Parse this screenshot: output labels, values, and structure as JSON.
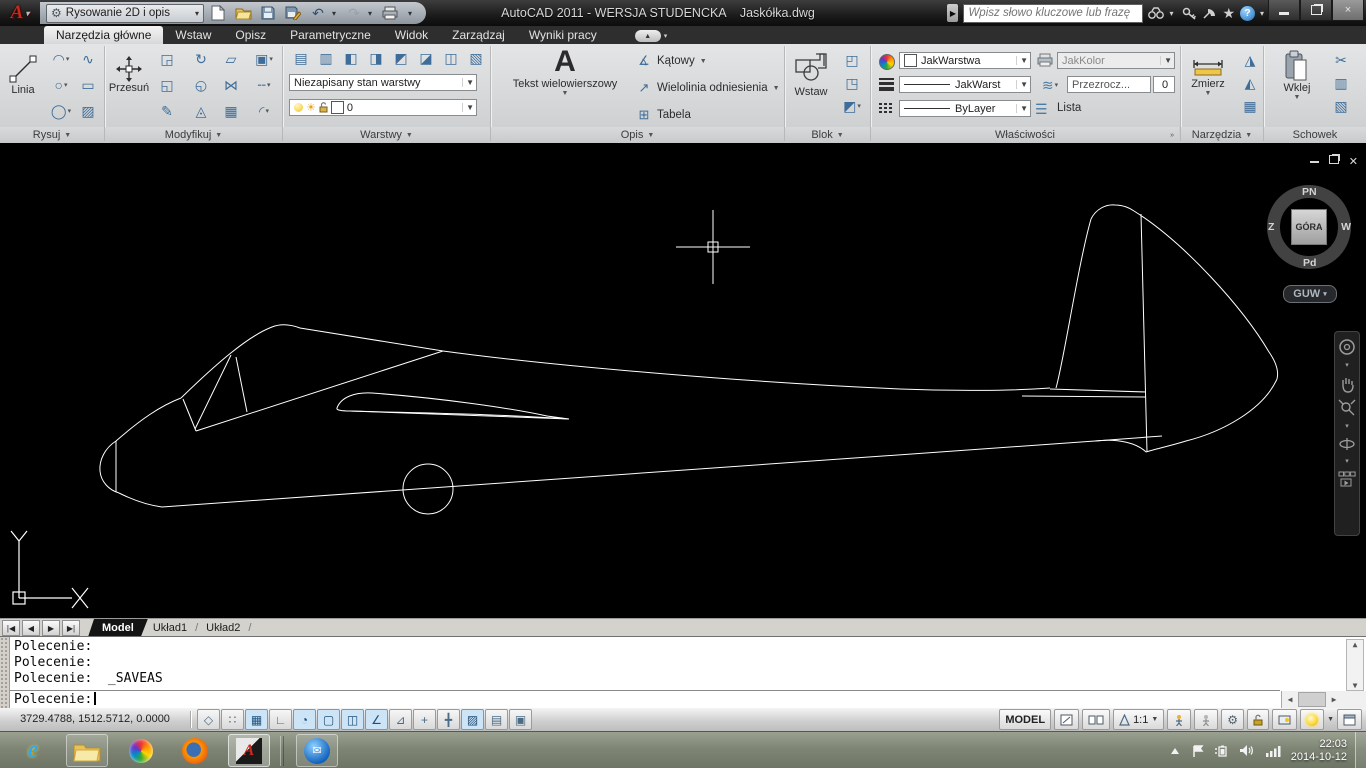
{
  "title_bar": {
    "app_logo": "A",
    "workspace_label": "Rysowanie 2D i opis",
    "window_title": "AutoCAD 2011 - WERSJA STUDENCKA    Jaskółka.dwg",
    "search_placeholder": "Wpisz słowo kluczowe lub frazę",
    "qat_icons": [
      "new-file",
      "open-file",
      "save",
      "save-as",
      "undo",
      "redo",
      "plot"
    ]
  },
  "ribbon": {
    "tabs": [
      {
        "label": "Narzędzia główne",
        "active": true
      },
      {
        "label": "Wstaw",
        "active": false
      },
      {
        "label": "Opisz",
        "active": false
      },
      {
        "label": "Parametryczne",
        "active": false
      },
      {
        "label": "Widok",
        "active": false
      },
      {
        "label": "Zarządzaj",
        "active": false
      },
      {
        "label": "Wyniki pracy",
        "active": false
      }
    ],
    "panels": {
      "rysuj": {
        "label": "Rysuj",
        "big_button": "Linia",
        "tools": [
          {
            "name": "arc",
            "glyph": "◠",
            "dd": true
          },
          {
            "name": "polyline",
            "glyph": "∿",
            "dd": false
          },
          {
            "name": "circle",
            "glyph": "○",
            "dd": true
          },
          {
            "name": "rectangle",
            "glyph": "▭",
            "dd": false
          },
          {
            "name": "ellipse",
            "glyph": "◯",
            "dd": true
          },
          {
            "name": "hatch",
            "glyph": "▨",
            "dd": false
          }
        ]
      },
      "modyfikuj": {
        "label": "Modyfikuj",
        "big_button": "Przesuń",
        "tools": [
          {
            "name": "copy",
            "glyph": "◲",
            "dd": false
          },
          {
            "name": "rotate",
            "glyph": "↻",
            "dd": false
          },
          {
            "name": "stretch",
            "glyph": "▱",
            "dd": false
          },
          {
            "name": "overlap-order",
            "glyph": "▣",
            "dd": true
          },
          {
            "name": "scale",
            "glyph": "◱",
            "dd": false
          },
          {
            "name": "fillet-polygon",
            "glyph": "◵",
            "dd": false
          },
          {
            "name": "mirror",
            "glyph": "⋈",
            "dd": false
          },
          {
            "name": "break",
            "glyph": "╌",
            "dd": true
          },
          {
            "name": "erase",
            "glyph": "✎",
            "dd": false
          },
          {
            "name": "explode",
            "glyph": "◬",
            "dd": false
          },
          {
            "name": "array",
            "glyph": "▦",
            "dd": false
          },
          {
            "name": "fillet",
            "glyph": "◜",
            "dd": true
          }
        ]
      },
      "warstwy": {
        "label": "Warstwy",
        "state_dropdown": "Niezapisany stan warstwy",
        "current_layer": "0",
        "tools": [
          "layer-properties",
          "layer-match",
          "layer-isolate",
          "layer-unisolate",
          "layer-freeze",
          "layer-off",
          "layer-lock",
          "layer-walk"
        ]
      },
      "opis": {
        "label": "Opis",
        "big_button": "Tekst wielowierszowy",
        "items": [
          {
            "name": "angular-dimension",
            "label": "Kątowy",
            "glyph": "∡",
            "dd": true
          },
          {
            "name": "multileader",
            "label": "Wielolinia odniesienia",
            "glyph": "↗",
            "dd": true
          },
          {
            "name": "table",
            "label": "Tabela",
            "glyph": "⊞",
            "dd": false
          }
        ]
      },
      "blok": {
        "label": "Blok",
        "big_button": "Wstaw",
        "tools": [
          "create-block",
          "edit-attribute",
          "define-attribute"
        ]
      },
      "wlasciwosci": {
        "label": "Właściwości",
        "object_color": "JakWarstwa",
        "plot_style": "JakKolor",
        "lineweight": "JakWarst",
        "linetype": "ByLayer",
        "transparency_label": "Przezrocz...",
        "transparency_value": "0",
        "list_label": "Lista"
      },
      "narzedzia": {
        "label": "Narzędzia",
        "big_button": "Zmierz",
        "tools": [
          "quick-select",
          "select-similar",
          "quick-calculator"
        ]
      },
      "schowek": {
        "label": "Schowek",
        "big_button": "Wklej",
        "tools": [
          "cut",
          "copy-clip",
          "paste-special"
        ]
      }
    }
  },
  "canvas": {
    "viewcube": {
      "north": "PN",
      "east": "W",
      "south": "Pd",
      "west": "Z",
      "top_face": "GÓRA",
      "ucs_label": "GUW"
    },
    "navbar_icons": [
      "steering-wheel",
      "pan-hand",
      "zoom",
      "orbit",
      "showmotion"
    ]
  },
  "layout_tabs": {
    "model": "Model",
    "layout1": "Układ1",
    "layout2": "Układ2"
  },
  "command_line": {
    "history": [
      "Polecenie:",
      "Polecenie:",
      "Polecenie:  _SAVEAS"
    ],
    "prompt": "Polecenie:"
  },
  "status_bar": {
    "coordinates": "3729.4788, 1512.5712, 0.0000",
    "toggles": [
      {
        "name": "snap-mode",
        "glyph": "◇",
        "on": false
      },
      {
        "name": "grid-display",
        "glyph": "∷",
        "on": false
      },
      {
        "name": "grid",
        "glyph": "▦",
        "on": true
      },
      {
        "name": "ortho-mode",
        "glyph": "∟",
        "on": false
      },
      {
        "name": "polar-tracking",
        "glyph": "◔",
        "on": true
      },
      {
        "name": "object-snap",
        "glyph": "▢",
        "on": true
      },
      {
        "name": "3d-object-snap",
        "glyph": "◫",
        "on": true
      },
      {
        "name": "object-snap-tracking",
        "glyph": "∠",
        "on": true
      },
      {
        "name": "dynamic-ucs",
        "glyph": "⊿",
        "on": false
      },
      {
        "name": "dynamic-input",
        "glyph": "+",
        "on": false
      },
      {
        "name": "lineweight-display",
        "glyph": "╋",
        "on": false
      },
      {
        "name": "transparency-display",
        "glyph": "▨",
        "on": true
      },
      {
        "name": "quick-properties",
        "glyph": "▤",
        "on": false
      },
      {
        "name": "selection-cycling",
        "glyph": "▣",
        "on": false
      }
    ],
    "model_button": "MODEL",
    "annotation_scale": "1:1"
  },
  "taskbar": {
    "apps": [
      {
        "name": "internet-explorer",
        "open": false,
        "active": false
      },
      {
        "name": "windows-explorer",
        "open": true,
        "active": false
      },
      {
        "name": "software-updater",
        "open": false,
        "active": false
      },
      {
        "name": "firefox",
        "open": false,
        "active": false
      },
      {
        "name": "autocad",
        "open": true,
        "active": true
      },
      {
        "name": "thunderbird",
        "open": true,
        "active": false
      }
    ],
    "tray_icons": [
      "hidden-icons",
      "action-center",
      "battery",
      "volume",
      "network"
    ],
    "clock_time": "22:03",
    "clock_date": "2014-10-12"
  }
}
